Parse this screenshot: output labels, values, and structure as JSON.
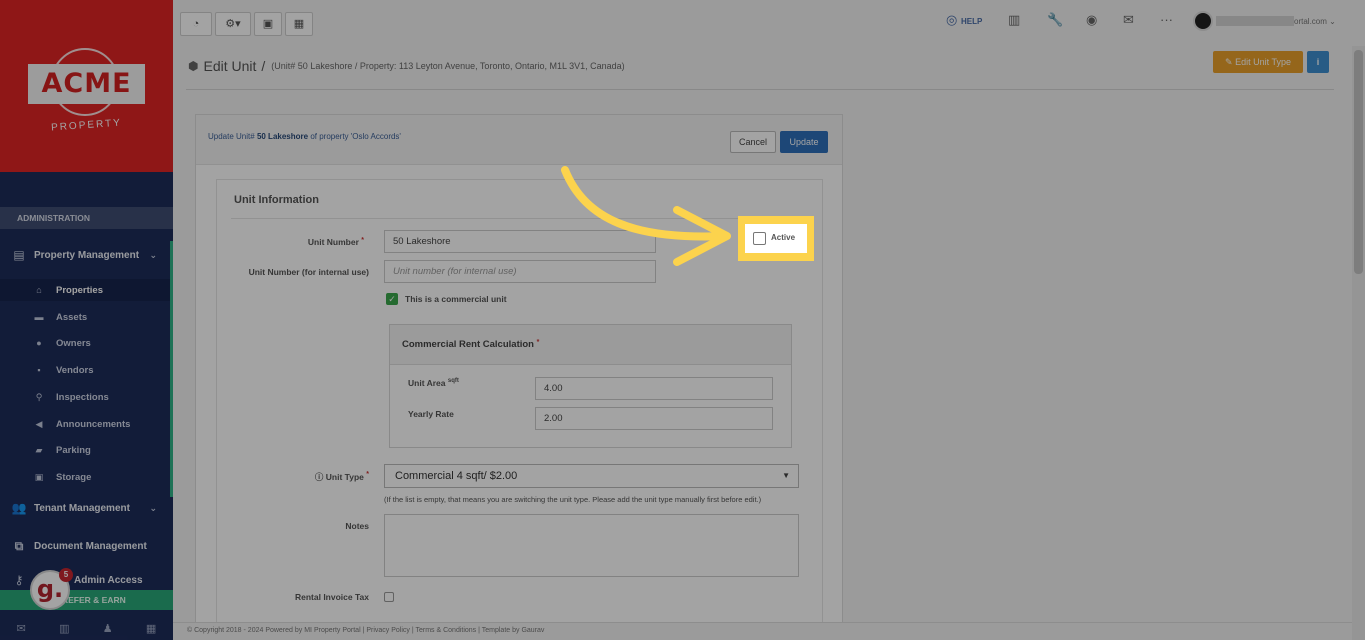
{
  "brand": {
    "name": "ACME",
    "tagline": "PROPERTY"
  },
  "sidebar": {
    "section_label": "ADMINISTRATION",
    "groups": [
      {
        "label": "Property Management",
        "icon": "building-icon"
      },
      {
        "label": "Tenant Management",
        "icon": "users-icon"
      },
      {
        "label": "Document Management",
        "icon": "documents-icon"
      },
      {
        "label": "Admin Access",
        "icon": "key-icon"
      }
    ],
    "items": [
      {
        "label": "Properties",
        "icon": "home-icon"
      },
      {
        "label": "Assets",
        "icon": "asset-icon"
      },
      {
        "label": "Owners",
        "icon": "user-icon"
      },
      {
        "label": "Vendors",
        "icon": "briefcase-icon"
      },
      {
        "label": "Inspections",
        "icon": "search-icon"
      },
      {
        "label": "Announcements",
        "icon": "megaphone-icon"
      },
      {
        "label": "Parking",
        "icon": "car-icon"
      },
      {
        "label": "Storage",
        "icon": "storage-icon"
      }
    ],
    "refer": "REFER & EARN",
    "badge_letter": "g.",
    "badge_count": "5"
  },
  "topbar": {
    "help": "HELP",
    "user_email_suffix": "ortal.com"
  },
  "page": {
    "title": "Edit Unit",
    "separator": "/",
    "subtitle": "(Unit# 50 Lakeshore / Property: 113 Leyton Avenue, Toronto, Ontario, M1L 3V1, Canada)",
    "edit_unit_type": "Edit Unit Type",
    "info_btn": "i"
  },
  "panel": {
    "note_prefix": "Update Unit#",
    "note_unit": "50 Lakeshore",
    "note_suffix": "of property 'Oslo Accords'",
    "cancel": "Cancel",
    "update": "Update"
  },
  "form": {
    "section_title": "Unit Information",
    "unit_number_label": "Unit Number",
    "unit_number_value": "50 Lakeshore",
    "internal_label": "Unit Number (for internal use)",
    "internal_placeholder": "Unit number (for internal use)",
    "active_label": "Active",
    "active_checked": false,
    "commercial_label": "This is a commercial unit",
    "commercial_checked": true,
    "rent_calc_title": "Commercial Rent Calculation",
    "unit_area_label": "Unit Area",
    "unit_area_unit": "sqft",
    "unit_area_value": "4.00",
    "yearly_rate_label": "Yearly Rate",
    "yearly_rate_value": "2.00",
    "unit_type_label": "Unit Type",
    "unit_type_value": "Commercial 4 sqft/ $2.00",
    "unit_type_hint": "(If the list is empty, that means you are switching the unit type. Please add the unit type manually first before edit.)",
    "notes_label": "Notes",
    "rental_tax_label": "Rental Invoice Tax"
  },
  "footer": {
    "text": "© Copyright 2018 - 2024 Powered by MI Property Portal | Privacy Policy | Terms & Conditions | Template by Gaurav"
  },
  "colors": {
    "brand_red": "#e02424",
    "sidebar_navy": "#1d2c5a",
    "highlight_yellow": "#fcd34d",
    "primary_blue": "#2e6fba",
    "warning_orange": "#e9a02b",
    "success_green": "#2aa879"
  }
}
